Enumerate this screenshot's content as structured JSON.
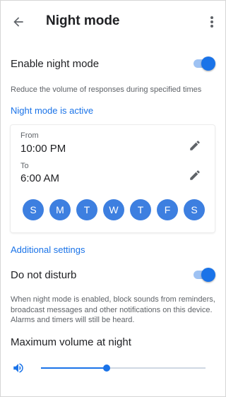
{
  "header": {
    "title": "Night mode"
  },
  "enable_night_mode": {
    "label": "Enable night mode",
    "enabled": true,
    "description": "Reduce the volume of responses during specified times"
  },
  "status_link": "Night mode is active",
  "schedule": {
    "from_label": "From",
    "from_time": "10:00 PM",
    "to_label": "To",
    "to_time": "6:00 AM",
    "days": [
      "S",
      "M",
      "T",
      "W",
      "T",
      "F",
      "S"
    ]
  },
  "additional_settings_link": "Additional settings",
  "do_not_disturb": {
    "label": "Do not disturb",
    "enabled": true,
    "description_lines": [
      "When night mode is enabled, block sounds from reminders,",
      "broadcast messages and other notifications on this device.",
      "Alarms and timers will still be heard."
    ]
  },
  "max_volume": {
    "label": "Maximum volume at night",
    "level_fraction": 0.4
  },
  "colors": {
    "accent": "#1a73e8",
    "day_chip": "#3d7fe0",
    "toggle_track": "#9ec2f3",
    "text_primary": "#202124",
    "text_secondary": "#5f6368"
  },
  "icons": {
    "back": "arrow-back-icon",
    "more": "more-vert-icon",
    "edit": "pencil-icon",
    "volume": "volume-up-icon"
  }
}
